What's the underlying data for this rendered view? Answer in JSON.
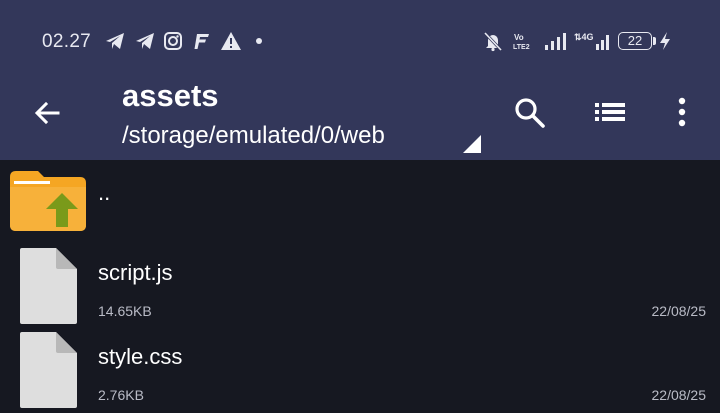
{
  "status": {
    "time": "02.27",
    "battery": "22",
    "network": "4G",
    "volte": "Vo LTE2"
  },
  "toolbar": {
    "title": "assets",
    "path": "/storage/emulated/0/web"
  },
  "files": [
    {
      "name": "..",
      "kind": "parent-folder"
    },
    {
      "name": "script.js",
      "size": "14.65KB",
      "date": "22/08/25",
      "kind": "file"
    },
    {
      "name": "style.css",
      "size": "2.76KB",
      "date": "22/08/25",
      "kind": "file"
    }
  ],
  "colors": {
    "appbar": "#33375a",
    "background": "#161821",
    "folder": "#f5a623",
    "folder_arrow": "#7a9a1a"
  }
}
